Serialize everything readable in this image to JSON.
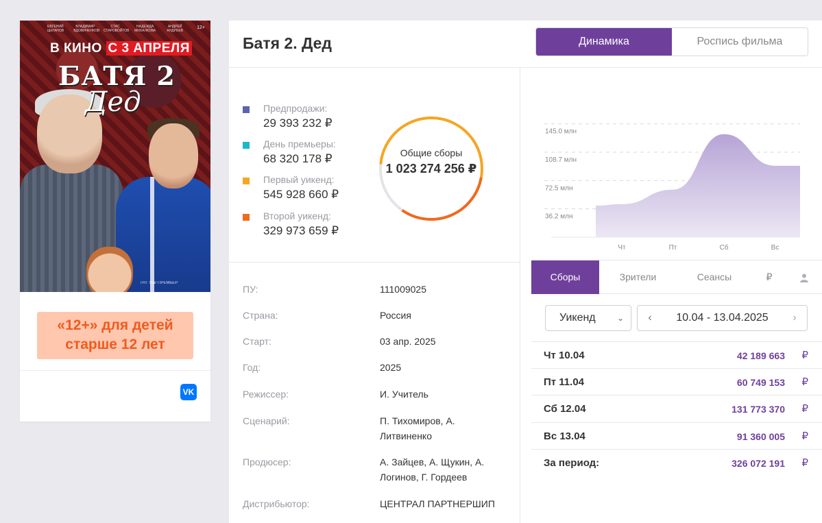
{
  "poster": {
    "cast": [
      "ЕВГЕНИЙ ЦЫГАНОВ",
      "ВЛАДИМИР ВДОВИЧЕНКОВ",
      "СТАС СТАРОВОЙТОВ",
      "НАДЕЖДА МИХАЛКОВА",
      "АНДРЕЙ АНДРЕЕВ"
    ],
    "age_small": "12+",
    "release_prefix": "В КИНО",
    "release_highlight": "С 3 АПРЕЛЯ",
    "title": "БАТЯ 2",
    "subtitle": "Дед",
    "logos": "ТНТ  Star  ПРЕМЬЕР"
  },
  "age_badge": "«12+» для детей старше 12 лет",
  "vk_label": "VK",
  "header": {
    "title": "Батя 2. Дед",
    "tabs": [
      {
        "label": "Динамика",
        "active": true
      },
      {
        "label": "Роспись фильма",
        "active": false
      }
    ]
  },
  "stats": {
    "items": [
      {
        "label": "Предпродажи:",
        "value": "29 393 232 ₽",
        "color": "#5a64b0"
      },
      {
        "label": "День премьеры:",
        "value": "68 320 178 ₽",
        "color": "#1bb8c9"
      },
      {
        "label": "Первый уикенд:",
        "value": "545 928 660 ₽",
        "color": "#f5a623"
      },
      {
        "label": "Второй уикенд:",
        "value": "329 973 659 ₽",
        "color": "#f06a1c"
      }
    ],
    "total_label": "Общие сборы",
    "total_value": "1 023 274 256 ₽"
  },
  "info": [
    {
      "key": "ПУ:",
      "value": "111009025"
    },
    {
      "key": "Страна:",
      "value": "Россия"
    },
    {
      "key": "Старт:",
      "value": "03 апр. 2025"
    },
    {
      "key": "Год:",
      "value": "2025"
    },
    {
      "key": "Режиссер:",
      "value": "И. Учитель"
    },
    {
      "key": "Сценарий:",
      "value": "П. Тихомиров, А. Литвиненко"
    },
    {
      "key": "Продюсер:",
      "value": "А. Зайцев, А. Щукин, А. Логинов, Г. Гордеев"
    },
    {
      "key": "Дистрибьютор:",
      "value": "ЦЕНТРАЛ ПАРТНЕРШИП"
    }
  ],
  "chart_data": {
    "type": "area",
    "categories": [
      "Чт",
      "Пт",
      "Сб",
      "Вс"
    ],
    "values": [
      42.19,
      60.75,
      131.77,
      91.36
    ],
    "y_ticks": [
      "36.2 млн",
      "72.5 млн",
      "108.7 млн",
      "145.0 млн"
    ],
    "ylim": [
      0,
      145.0
    ],
    "color": "#c4b5dc",
    "grid": true
  },
  "subtabs": [
    {
      "label": "Сборы",
      "active": true,
      "icon": ""
    },
    {
      "label": "Зрители",
      "active": false,
      "icon": ""
    },
    {
      "label": "Сеансы",
      "active": false,
      "icon": ""
    },
    {
      "label": "₽",
      "active": false,
      "icon": "ruble-icon"
    },
    {
      "label": "",
      "active": false,
      "icon": "person-icon"
    }
  ],
  "period_select": "Уикенд",
  "date_range": "10.04 - 13.04.2025",
  "days": [
    {
      "day": "Чт 10.04",
      "amount": "42 189 663"
    },
    {
      "day": "Пт 11.04",
      "amount": "60 749 153"
    },
    {
      "day": "Сб 12.04",
      "amount": "131 773 370"
    },
    {
      "day": "Вс 13.04",
      "amount": "91 360 005"
    },
    {
      "day": "За период:",
      "amount": "326 072 191"
    }
  ],
  "currency": "₽"
}
